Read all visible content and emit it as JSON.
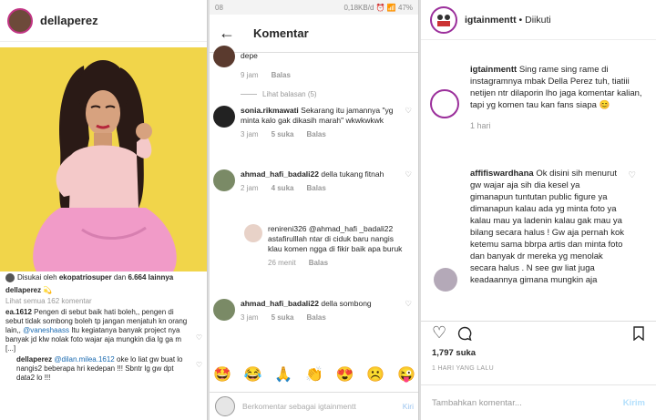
{
  "panel1": {
    "username": "dellaperez",
    "liked_by_prefix": "Disukai oleh",
    "liked_by_user": "ekopatriosuper",
    "liked_by_and": "dan",
    "liked_by_count": "6.664 lainnya",
    "caption_user": "dellaperez",
    "caption_emoji": "💫",
    "view_all": "Lihat semua 162 komentar",
    "comment1_user": "ea.1612",
    "comment1_text_a": "Pengen di sebut baik hati boleh,, pengen di sebut tidak sombong boleh tp jangan menjatuh kn orang lain,,",
    "comment1_mention": "@vaneshaass",
    "comment1_text_b": "Itu kegiatanya banyak project nya banyak jd klw nolak foto wajar aja mungkin dia lg ga m [...]",
    "comment2_user": "dellaperez",
    "comment2_mention": "@dilan.milea.1612",
    "comment2_text": "oke lo liat gw buat lo nangis2 beberapa hri kedepan !!! Sbntr lg gw dpt data2 lo !!!"
  },
  "panel2": {
    "status_time": "08",
    "status_right": "0,18KB/d ⏰ 📶 47%",
    "title": "Komentar",
    "c0_text": "depe",
    "c0_time": "9 jam",
    "c0_reply": "Balas",
    "view_replies": "Lihat balasan (5)",
    "c1_user": "sonia.rikmawati",
    "c1_text": "Sekarang itu jamannya \"yg minta kalo gak dikasih marah\" wkwkwkwk",
    "c1_time": "3 jam",
    "c1_likes": "5 suka",
    "c1_reply": "Balas",
    "c2_user": "ahmad_hafi_badali22",
    "c2_text": "della tukang fitnah",
    "c2_time": "2 jam",
    "c2_likes": "4 suka",
    "c2_reply": "Balas",
    "c3_user": "renireni326",
    "c3_mention": "@ahmad_hafi _badali22",
    "c3_text": "astafirulllah ntar di ciduk baru nangis klau komen ngga di fikir baik apa buruk",
    "c3_time": "26 menit",
    "c3_reply": "Balas",
    "c4_user": "ahmad_hafi_badali22",
    "c4_text": "della sombong",
    "c4_time": "3 jam",
    "c4_likes": "5 suka",
    "c4_reply": "Balas",
    "emojis": [
      "🤩",
      "😂",
      "🙏",
      "👏",
      "😍",
      "☹️",
      "😜"
    ],
    "composer_placeholder": "Berkomentar sebagai igtainmentt",
    "composer_send": "Kiri"
  },
  "panel3": {
    "username": "igtainmentt",
    "separator": "•",
    "follow_status": "Diikuti",
    "caption_user": "igtainmentt",
    "caption_text": "Sing rame sing rame di instagramnya mbak Della Perez tuh, tiatiii netijen ntr dilaporin lho jaga komentar kalian, tapi yg komen tau kan fans siapa 😊",
    "caption_time": "1 hari",
    "comment_user": "affifiswardhana",
    "comment_text": "Ok disini sih menurut gw wajar aja sih dia kesel ya gimanapun tuntutan public figure ya dimanapun kalau ada yg minta foto ya kalau mau ya ladenin kalau gak mau ya bilang secara halus ! Gw aja pernah kok ketemu sama bbrpa artis dan minta foto dan banyak dr mereka yg menolak secara halus . N see gw liat juga keadaannya gimana mungkin aja",
    "likes": "1,797 suka",
    "posted_time": "1 HARI YANG LALU",
    "add_comment_placeholder": "Tambahkan komentar...",
    "send_label": "Kirim"
  },
  "colors": {
    "photo_bg": "#f1d54a",
    "link_blue": "#3897f0",
    "story_ring": "#c13584"
  }
}
